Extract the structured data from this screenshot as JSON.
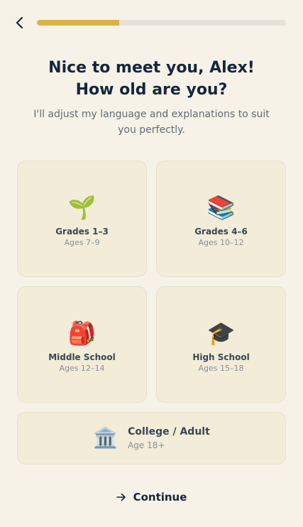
{
  "header": {
    "back_icon": "chevron-left-icon",
    "progress_percent": 33,
    "progress_color": "#d8b446",
    "track_color": "#e6e2d9"
  },
  "intro": {
    "title_line1": "Nice to meet you, Alex!",
    "title_line2": "How old are you?",
    "subtitle": "I'll adjust my language and explanations to suit you perfectly."
  },
  "options": [
    {
      "icon": "seedling-icon",
      "emoji": "🌱",
      "label": "Grades 1–3",
      "ages": "Ages 7–9"
    },
    {
      "icon": "books-icon",
      "emoji": "📚",
      "label": "Grades 4–6",
      "ages": "Ages 10–12"
    },
    {
      "icon": "backpack-icon",
      "emoji": "🎒",
      "label": "Middle School",
      "ages": "Ages 12–14"
    },
    {
      "icon": "graduation-cap-icon",
      "emoji": "🎓",
      "label": "High School",
      "ages": "Ages 15–18"
    },
    {
      "icon": "classical-building-icon",
      "emoji": "🏛️",
      "label": "College / Adult",
      "ages": "Age 18+"
    }
  ],
  "footer": {
    "continue_label": "Continue",
    "continue_icon": "arrow-right-icon"
  },
  "colors": {
    "background": "#f7f2e7",
    "card": "#f2ecd9",
    "heading": "#14263f"
  }
}
